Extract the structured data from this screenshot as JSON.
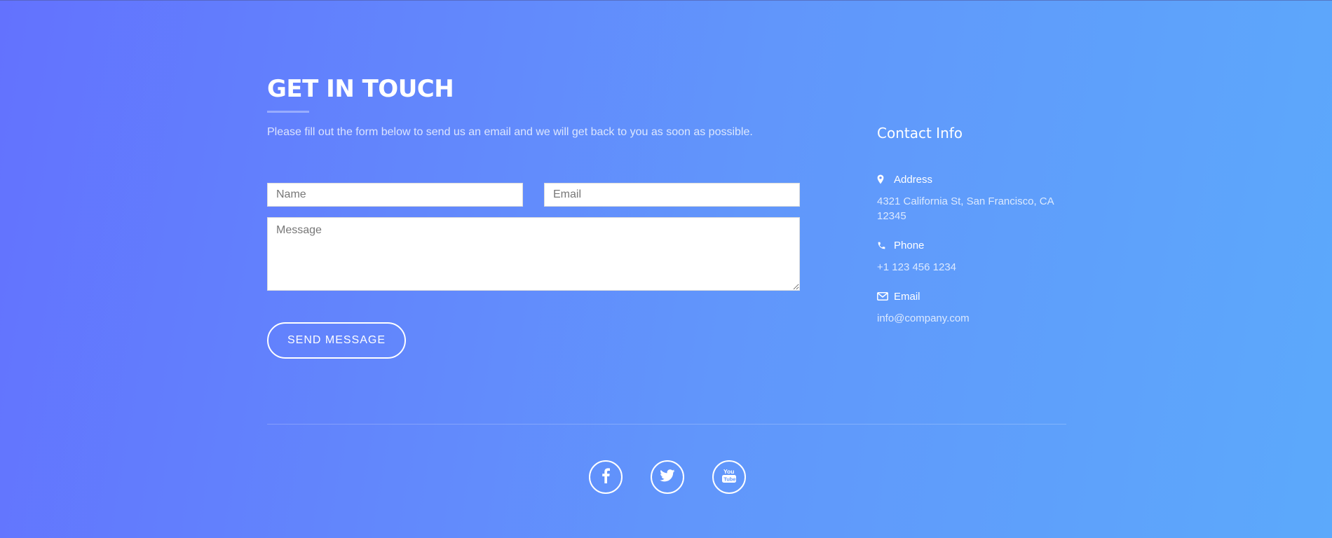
{
  "contact": {
    "title": "GET IN TOUCH",
    "subtitle": "Please fill out the form below to send us an email and we will get back to you as soon as possible.",
    "form": {
      "name_placeholder": "Name",
      "email_placeholder": "Email",
      "message_placeholder": "Message",
      "submit_label": "SEND MESSAGE"
    }
  },
  "contact_info": {
    "heading": "Contact Info",
    "address": {
      "label": "Address",
      "value": "4321 California St, San Francisco, CA 12345",
      "icon": "map-marker-icon"
    },
    "phone": {
      "label": "Phone",
      "value": "+1 123 456 1234",
      "icon": "phone-icon"
    },
    "email": {
      "label": "Email",
      "value": "info@company.com",
      "icon": "envelope-icon"
    }
  },
  "social": [
    {
      "name": "facebook",
      "icon": "facebook-icon"
    },
    {
      "name": "twitter",
      "icon": "twitter-icon"
    },
    {
      "name": "youtube",
      "icon": "youtube-icon"
    }
  ],
  "colors": {
    "gradient_start": "#6372fe",
    "gradient_end": "#5ca9fb",
    "text": "#ffffff"
  }
}
